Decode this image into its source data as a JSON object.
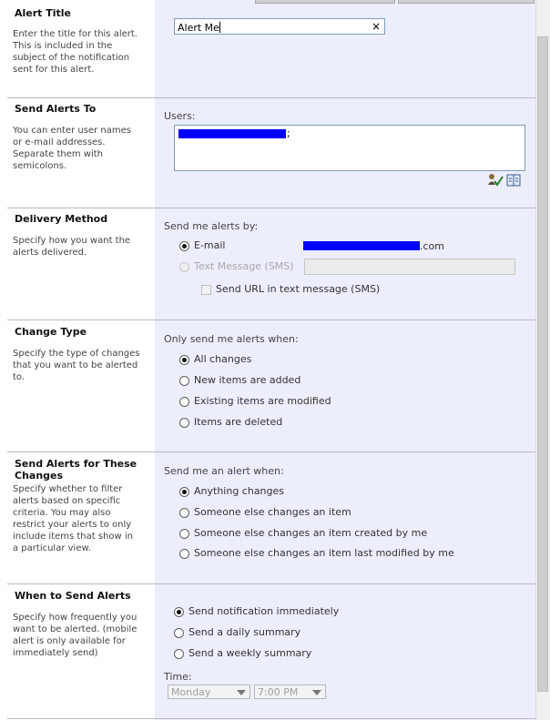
{
  "sections": {
    "alert_title": {
      "title": "Alert Title",
      "description": "Enter the title for this alert. This is included in the subject of the notification sent for this alert.",
      "input_value": "Alert Me",
      "clear_glyph": "×"
    },
    "send_alerts_to": {
      "title": "Send Alerts To",
      "description": "You can enter user names or e-mail addresses. Separate them with semicolons.",
      "users_label": "Users:",
      "users_suffix": ";",
      "check_names_icon": "check-names-icon",
      "address_book_icon": "address-book-icon"
    },
    "delivery_method": {
      "title": "Delivery Method",
      "description": "Specify how you want the alerts delivered.",
      "prompt": "Send me alerts by:",
      "options": [
        {
          "label": "E-mail",
          "checked": true,
          "disabled": false
        },
        {
          "label": "Text Message (SMS)",
          "checked": false,
          "disabled": true
        }
      ],
      "email_suffix": ".com",
      "sms_url_label": "Send URL in text message (SMS)"
    },
    "change_type": {
      "title": "Change Type",
      "description": "Specify the type of changes that you want to be alerted to.",
      "prompt": "Only send me alerts when:",
      "options": [
        {
          "label": "All changes",
          "checked": true
        },
        {
          "label": "New items are added",
          "checked": false
        },
        {
          "label": "Existing items are modified",
          "checked": false
        },
        {
          "label": "Items are deleted",
          "checked": false
        }
      ]
    },
    "send_alerts_for_changes": {
      "title": "Send Alerts for These Changes",
      "description": "Specify whether to filter alerts based on specific criteria. You may also restrict your alerts to only include items that show in a particular view.",
      "prompt": "Send me an alert when:",
      "options": [
        {
          "label": "Anything changes",
          "checked": true
        },
        {
          "label": "Someone else changes an item",
          "checked": false
        },
        {
          "label": "Someone else changes an item created by me",
          "checked": false
        },
        {
          "label": "Someone else changes an item last modified by me",
          "checked": false
        }
      ]
    },
    "when_to_send": {
      "title": "When to Send Alerts",
      "description": "Specify how frequently you want to be alerted. (mobile alert is only available for immediately send)",
      "options": [
        {
          "label": "Send notification immediately",
          "checked": true
        },
        {
          "label": "Send a daily summary",
          "checked": false
        },
        {
          "label": "Send a weekly summary",
          "checked": false
        }
      ],
      "time_label": "Time:",
      "day_value": "Monday",
      "time_value": "7:00 PM"
    }
  },
  "colors": {
    "form_panel": "#eceefc",
    "redaction": "#0000ff"
  }
}
